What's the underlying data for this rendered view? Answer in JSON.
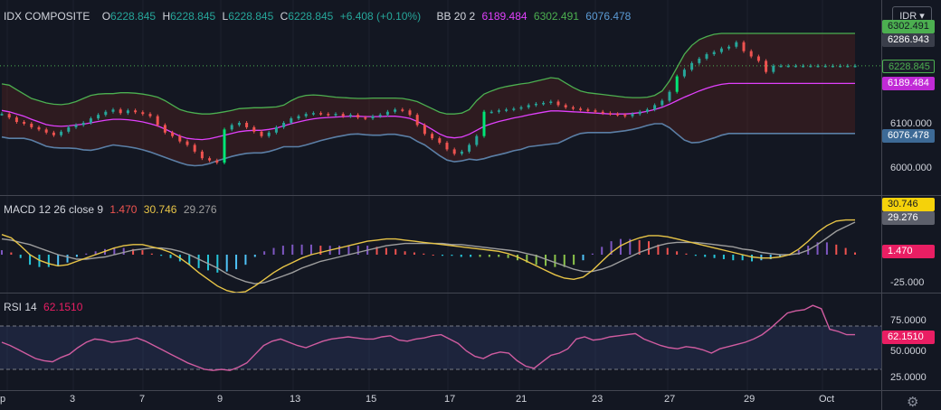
{
  "legend": {
    "symbol": "IDX COMPOSITE",
    "o_label": "O",
    "o_value": "6228.845",
    "h_label": "H",
    "h_value": "6228.845",
    "l_label": "L",
    "l_value": "6228.845",
    "c_label": "C",
    "c_value": "6228.845",
    "change": "+6.408 (+0.10%)",
    "bb_label": "BB 20 2",
    "bb_mid": "6189.484",
    "bb_upper": "6302.491",
    "bb_lower": "6076.478",
    "macd_label": "MACD 12 26 close 9",
    "macd_hist": "1.470",
    "macd_line": "30.746",
    "macd_signal": "29.276",
    "rsi_label": "RSI 14",
    "rsi_value": "62.1510"
  },
  "currency": "IDR",
  "tags": {
    "bb_upper": "6302.491",
    "high": "6286.943",
    "close": "6228.845",
    "bb_mid": "6189.484",
    "bb_lower": "6076.478",
    "macd_line": "30.746",
    "macd_signal": "29.276",
    "macd_hist": "1.470",
    "rsi": "62.1510"
  },
  "price_ticks": [
    "6100.000",
    "6000.000"
  ],
  "macd_ticks": [
    "-25.000"
  ],
  "rsi_ticks": [
    "75.0000",
    "50.0000",
    "25.0000"
  ],
  "x_labels": [
    "p",
    "3",
    "7",
    "9",
    "13",
    "15",
    "17",
    "21",
    "23",
    "27",
    "29",
    "Oct"
  ],
  "colors": {
    "up": "#26a69a",
    "up_bright": "#00e676",
    "down": "#ef5350",
    "bb_upper": "#4caf50",
    "bb_mid": "#e040fb",
    "bb_lower": "#5b7fa6",
    "macd": "#e8c547",
    "signal": "#9e9e9e",
    "rsi": "#d05ca0"
  },
  "chart_data": [
    {
      "type": "candlestick",
      "title": "IDX COMPOSITE",
      "x": [
        0,
        1,
        2,
        3,
        4,
        5,
        6,
        7,
        8,
        9,
        10,
        11,
        12,
        13,
        14,
        15,
        16,
        17,
        18,
        19,
        20,
        21,
        22,
        23,
        24,
        25,
        26,
        27,
        28,
        29,
        30,
        31,
        32,
        33,
        34,
        35,
        36,
        37,
        38,
        39,
        40,
        41,
        42,
        43,
        44,
        45,
        46,
        47,
        48,
        49,
        50,
        51,
        52,
        53,
        54,
        55,
        56,
        57,
        58,
        59,
        60,
        61,
        62,
        63,
        64,
        65,
        66,
        67,
        68,
        69,
        70,
        71,
        72,
        73,
        74,
        75,
        76,
        77,
        78,
        79,
        80,
        81,
        82,
        83,
        84,
        85,
        86,
        87,
        88,
        89,
        90,
        91,
        92,
        93,
        94,
        95,
        96,
        97,
        98,
        99,
        100,
        101,
        102,
        103,
        104,
        105,
        106,
        107,
        108,
        109,
        110,
        111,
        112,
        113,
        114,
        115
      ],
      "close": [
        6120,
        6112,
        6102,
        6098,
        6090,
        6085,
        6078,
        6072,
        6080,
        6090,
        6095,
        6100,
        6110,
        6118,
        6125,
        6130,
        6122,
        6128,
        6124,
        6120,
        6115,
        6095,
        6078,
        6070,
        6058,
        6050,
        6035,
        6020,
        6015,
        6010,
        6085,
        6095,
        6100,
        6090,
        6080,
        6070,
        6078,
        6090,
        6100,
        6110,
        6115,
        6120,
        6122,
        6120,
        6118,
        6120,
        6115,
        6118,
        6112,
        6110,
        6115,
        6118,
        6125,
        6130,
        6128,
        6118,
        6095,
        6075,
        6065,
        6055,
        6040,
        6030,
        6035,
        6050,
        6070,
        6125,
        6125,
        6128,
        6130,
        6132,
        6135,
        6140,
        6143,
        6145,
        6148,
        6140,
        6135,
        6132,
        6130,
        6128,
        6125,
        6122,
        6120,
        6118,
        6115,
        6120,
        6125,
        6130,
        6140,
        6150,
        6170,
        6205,
        6220,
        6235,
        6245,
        6255,
        6260,
        6268,
        6272,
        6282,
        6262,
        6250,
        6240,
        6215,
        6229,
        6229,
        6229,
        6229,
        6229,
        6229,
        6229,
        6229,
        6229,
        6229,
        6229,
        6229
      ],
      "bb_upper": [
        6188,
        6185,
        6175,
        6165,
        6155,
        6150,
        6145,
        6142,
        6141,
        6143,
        6148,
        6155,
        6162,
        6165,
        6166,
        6166,
        6168,
        6168,
        6167,
        6165,
        6162,
        6158,
        6150,
        6140,
        6130,
        6125,
        6122,
        6120,
        6120,
        6122,
        6125,
        6128,
        6132,
        6133,
        6134,
        6134,
        6135,
        6136,
        6140,
        6150,
        6158,
        6162,
        6163,
        6162,
        6160,
        6158,
        6157,
        6156,
        6155,
        6155,
        6156,
        6156,
        6156,
        6156,
        6155,
        6152,
        6148,
        6140,
        6132,
        6124,
        6120,
        6120,
        6122,
        6130,
        6150,
        6165,
        6172,
        6178,
        6182,
        6185,
        6188,
        6190,
        6194,
        6198,
        6202,
        6200,
        6190,
        6180,
        6172,
        6168,
        6166,
        6164,
        6162,
        6160,
        6158,
        6157,
        6157,
        6158,
        6162,
        6172,
        6195,
        6225,
        6255,
        6275,
        6288,
        6295,
        6300,
        6302,
        6302,
        6302,
        6302,
        6302,
        6302,
        6302,
        6302,
        6302,
        6302,
        6302,
        6302,
        6302,
        6302,
        6302,
        6302,
        6302,
        6302,
        6302
      ],
      "bb_mid": [
        6128,
        6125,
        6120,
        6115,
        6108,
        6102,
        6096,
        6093,
        6092,
        6093,
        6095,
        6097,
        6100,
        6103,
        6106,
        6108,
        6108,
        6107,
        6105,
        6102,
        6098,
        6093,
        6086,
        6078,
        6070,
        6065,
        6063,
        6062,
        6064,
        6068,
        6072,
        6076,
        6080,
        6082,
        6083,
        6083,
        6085,
        6088,
        6093,
        6098,
        6102,
        6106,
        6109,
        6111,
        6112,
        6113,
        6114,
        6115,
        6115,
        6114,
        6114,
        6114,
        6115,
        6115,
        6113,
        6110,
        6103,
        6095,
        6085,
        6075,
        6068,
        6066,
        6068,
        6074,
        6083,
        6092,
        6098,
        6103,
        6107,
        6111,
        6114,
        6118,
        6121,
        6124,
        6127,
        6127,
        6126,
        6125,
        6124,
        6123,
        6122,
        6121,
        6120,
        6120,
        6120,
        6121,
        6123,
        6126,
        6130,
        6135,
        6142,
        6150,
        6158,
        6165,
        6172,
        6178,
        6183,
        6187,
        6189,
        6189,
        6189,
        6189,
        6189,
        6189,
        6189,
        6189,
        6189,
        6189,
        6189,
        6189,
        6189,
        6189,
        6189,
        6189,
        6189,
        6189
      ],
      "bb_lower": [
        6068,
        6065,
        6065,
        6065,
        6061,
        6054,
        6047,
        6044,
        6043,
        6043,
        6042,
        6039,
        6038,
        6041,
        6046,
        6050,
        6048,
        6046,
        6043,
        6039,
        6034,
        6028,
        6022,
        6016,
        6010,
        6005,
        6003,
        6004,
        6008,
        6014,
        6019,
        6024,
        6028,
        6031,
        6032,
        6032,
        6035,
        6040,
        6046,
        6046,
        6046,
        6050,
        6055,
        6060,
        6064,
        6068,
        6071,
        6074,
        6075,
        6073,
        6072,
        6072,
        6074,
        6074,
        6071,
        6068,
        6058,
        6050,
        6038,
        6026,
        6016,
        6012,
        6014,
        6018,
        6016,
        6019,
        6024,
        6028,
        6032,
        6037,
        6040,
        6046,
        6048,
        6050,
        6052,
        6054,
        6062,
        6070,
        6076,
        6078,
        6078,
        6078,
        6078,
        6080,
        6082,
        6085,
        6089,
        6094,
        6098,
        6098,
        6089,
        6075,
        6061,
        6055,
        6056,
        6061,
        6066,
        6072,
        6076,
        6076,
        6076,
        6076,
        6076,
        6076,
        6076,
        6076,
        6076,
        6076,
        6076,
        6076,
        6076,
        6076,
        6076,
        6076,
        6076,
        6076
      ]
    },
    {
      "type": "line",
      "title": "MACD 12 26 close 9",
      "series": [
        {
          "name": "MACD",
          "values": [
            18,
            15,
            8,
            0,
            -5,
            -8,
            -10,
            -9,
            -6,
            -3,
            0,
            3,
            6,
            8,
            9,
            9,
            7,
            5,
            2,
            -3,
            -9,
            -16,
            -22,
            -28,
            -32,
            -34,
            -33,
            -28,
            -22,
            -16,
            -11,
            -7,
            -3,
            0,
            2,
            4,
            6,
            8,
            10,
            12,
            13,
            14,
            14,
            13,
            12,
            11,
            10,
            9,
            8,
            7,
            6,
            5,
            4,
            3,
            1,
            -2,
            -6,
            -10,
            -14,
            -18,
            -21,
            -22,
            -20,
            -14,
            -6,
            2,
            8,
            12,
            15,
            17,
            17,
            16,
            14,
            12,
            10,
            8,
            6,
            4,
            2,
            0,
            -2,
            -3,
            -3,
            -2,
            0,
            5,
            12,
            20,
            26,
            30,
            31,
            31
          ]
        },
        {
          "name": "Signal",
          "values": [
            14,
            13,
            11,
            9,
            6,
            3,
            0,
            -2,
            -4,
            -4,
            -3,
            -2,
            0,
            2,
            4,
            5,
            6,
            6,
            5,
            3,
            0,
            -4,
            -8,
            -12,
            -17,
            -21,
            -24,
            -26,
            -25,
            -22,
            -19,
            -16,
            -12,
            -9,
            -6,
            -4,
            -2,
            0,
            2,
            4,
            6,
            8,
            9,
            10,
            10,
            10,
            10,
            10,
            9,
            9,
            8,
            7,
            6,
            5,
            4,
            3,
            1,
            -1,
            -4,
            -7,
            -10,
            -13,
            -15,
            -15,
            -13,
            -10,
            -6,
            -2,
            2,
            5,
            8,
            10,
            11,
            11,
            11,
            10,
            9,
            8,
            7,
            5,
            4,
            2,
            1,
            0,
            0,
            1,
            4,
            9,
            15,
            21,
            25,
            29
          ]
        },
        {
          "name": "Histogram",
          "values": [
            4,
            2,
            -3,
            -9,
            -11,
            -11,
            -10,
            -7,
            -2,
            1,
            3,
            5,
            6,
            6,
            5,
            4,
            1,
            -1,
            -3,
            -6,
            -9,
            -12,
            -14,
            -16,
            -15,
            -13,
            -9,
            -2,
            3,
            6,
            8,
            9,
            9,
            9,
            8,
            8,
            8,
            8,
            8,
            8,
            7,
            6,
            5,
            3,
            2,
            1,
            0,
            -1,
            -1,
            -2,
            -2,
            -2,
            -2,
            -2,
            -3,
            -5,
            -7,
            -9,
            -10,
            -11,
            -11,
            -9,
            -5,
            1,
            7,
            12,
            14,
            14,
            13,
            12,
            9,
            6,
            3,
            1,
            -1,
            -2,
            -3,
            -4,
            -5,
            -5,
            -6,
            -5,
            -4,
            -2,
            0,
            4,
            8,
            11,
            11,
            9,
            6,
            2
          ]
        }
      ]
    },
    {
      "type": "line",
      "title": "RSI 14",
      "series": [
        {
          "name": "RSI",
          "values": [
            55,
            52,
            48,
            44,
            40,
            38,
            37,
            41,
            44,
            50,
            55,
            58,
            57,
            55,
            56,
            57,
            59,
            56,
            52,
            48,
            44,
            40,
            36,
            33,
            30,
            29,
            30,
            29,
            32,
            36,
            44,
            52,
            56,
            58,
            55,
            52,
            50,
            53,
            56,
            58,
            59,
            60,
            59,
            58,
            58,
            60,
            61,
            57,
            56,
            58,
            59,
            61,
            62,
            58,
            54,
            47,
            42,
            40,
            44,
            46,
            45,
            38,
            33,
            31,
            37,
            43,
            45,
            49,
            58,
            60,
            57,
            58,
            60,
            61,
            62,
            63,
            58,
            55,
            52,
            50,
            49,
            51,
            50,
            48,
            45,
            49,
            51,
            53,
            55,
            58,
            62,
            68,
            75,
            82,
            84,
            85,
            89,
            86,
            67,
            65,
            62,
            62
          ]
        }
      ]
    }
  ]
}
